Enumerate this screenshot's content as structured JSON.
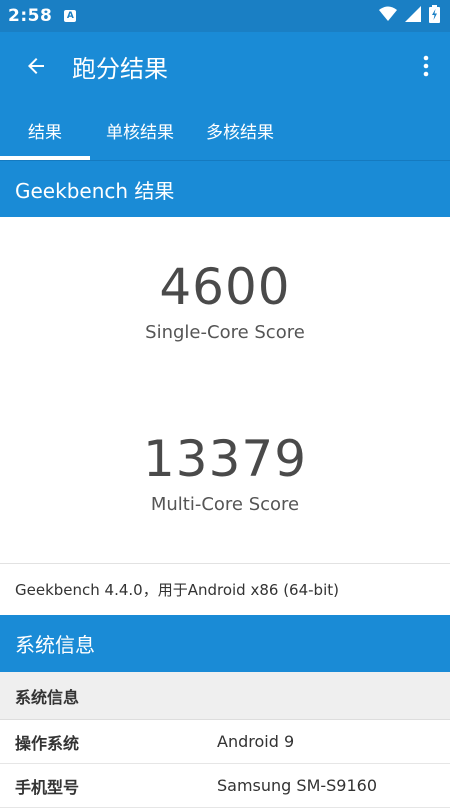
{
  "status_bar": {
    "time": "2:58",
    "app_icon_letter": "A"
  },
  "app_bar": {
    "title": "跑分结果"
  },
  "tabs": [
    {
      "label": "结果",
      "active": true
    },
    {
      "label": "单核结果",
      "active": false
    },
    {
      "label": "多核结果",
      "active": false
    }
  ],
  "results_section": {
    "title": "Geekbench 结果"
  },
  "scores": {
    "single": {
      "value": "4600",
      "label": "Single-Core Score"
    },
    "multi": {
      "value": "13379",
      "label": "Multi-Core Score"
    }
  },
  "version_text": "Geekbench 4.4.0，用于Android x86 (64-bit)",
  "system_section": {
    "title": "系统信息",
    "subheader": "系统信息"
  },
  "system_info": [
    {
      "key": "操作系统",
      "value": "Android 9"
    },
    {
      "key": "手机型号",
      "value": "Samsung SM-S9160"
    }
  ],
  "icons": {
    "back": "arrow-left-icon",
    "overflow": "more-vert-icon",
    "wifi": "wifi-icon",
    "signal": "signal-icon",
    "battery": "battery-icon"
  },
  "colors": {
    "primary": "#1a8bd6",
    "status_bar": "#1a7fc4"
  }
}
